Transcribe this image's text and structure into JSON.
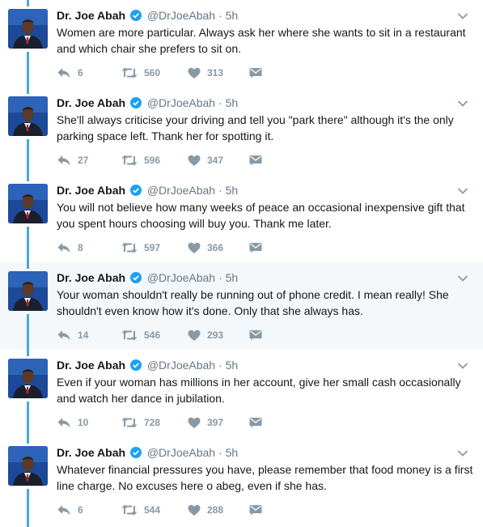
{
  "author": {
    "name": "Dr. Joe Abah",
    "handle": "@DrJoeAbah",
    "separator": "·",
    "time": "5h"
  },
  "colors": {
    "thread_line": "#4aa8d9",
    "verified": "#1da1f2",
    "action": "#8899a6",
    "highlight_bg": "#f5f8fa"
  },
  "icons": {
    "reply": "reply-icon",
    "retweet": "retweet-icon",
    "like": "heart-icon",
    "dm": "direct-message-icon",
    "menu": "chevron-down-icon",
    "verified": "verified-badge-icon"
  },
  "tweets": [
    {
      "text": "Women are more particular. Always ask her where she wants to sit in a restaurant and which chair she prefers to sit on.",
      "replies": "6",
      "retweets": "560",
      "likes": "313"
    },
    {
      "text": "She'll always criticise your driving and tell you \"park there\" although it's the only parking space left. Thank her for spotting it.",
      "replies": "27",
      "retweets": "596",
      "likes": "347"
    },
    {
      "text": "You will not believe how many weeks of peace an occasional inexpensive gift that you spent hours choosing will buy you. Thank me later.",
      "replies": "8",
      "retweets": "597",
      "likes": "366"
    },
    {
      "text": "Your woman shouldn't really be running out of phone credit. I mean really! She shouldn't even know how it's done. Only that she always has.",
      "replies": "14",
      "retweets": "546",
      "likes": "293"
    },
    {
      "text": "Even if your woman has millions in her account, give her small cash occasionally and watch her dance in jubilation.",
      "replies": "10",
      "retweets": "728",
      "likes": "397"
    },
    {
      "text": "Whatever financial pressures you have, please remember that food money is a first line charge. No excuses here o abeg, even if she has.",
      "replies": "6",
      "retweets": "544",
      "likes": "288"
    }
  ]
}
